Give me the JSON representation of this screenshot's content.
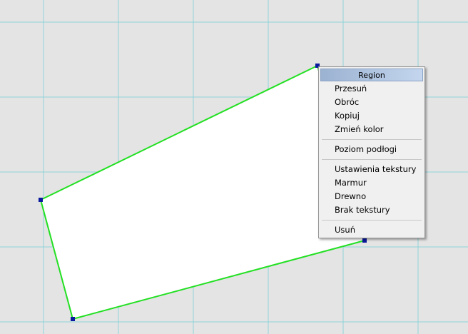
{
  "scene": {
    "background_color": "#e4e4e4",
    "grid_color": "#8fd3d8",
    "polygon_fill": "#ffffff",
    "polygon_stroke": "#22e022",
    "handle_color": "#0a1a9e"
  },
  "context_menu": {
    "header": "Region",
    "groups": [
      [
        "Przesuń",
        "Obróc",
        "Kopiuj",
        "Zmień kolor"
      ],
      [
        "Poziom podłogi"
      ],
      [
        "Ustawienia tekstury",
        "Marmur",
        "Drewno",
        "Brak tekstury"
      ],
      [
        "Usuń"
      ]
    ]
  }
}
